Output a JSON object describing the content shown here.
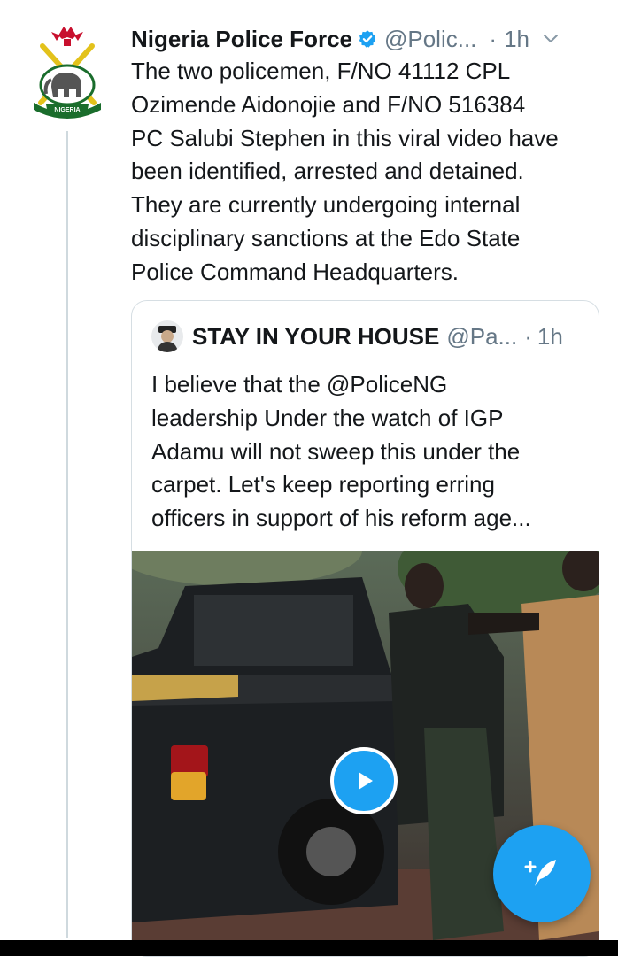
{
  "tweet": {
    "author_name": "Nigeria Police Force",
    "handle": "@Polic...",
    "separator": "·",
    "time": "1h",
    "avatar_label": "NIGERIA",
    "text_lines": [
      "The two policemen, F/NO 41112 CPL",
      "Ozimende Aidonojie and F/NO 516384",
      "PC Salubi Stephen in this viral video have",
      "been identified, arrested and detained.",
      "They are currently undergoing internal",
      "disciplinary sanctions at the Edo State",
      "Police Command Headquarters."
    ]
  },
  "quoted_tweet": {
    "author_name": "STAY IN YOUR HOUSE",
    "handle": "@Pa...",
    "separator": "·",
    "time": "1h",
    "text_lines": [
      "I believe that the @PoliceNG",
      "leadership  Under the watch of IGP",
      "Adamu will not sweep this under the",
      "carpet. Let's keep reporting erring",
      "officers in support of his reform age..."
    ],
    "media": {
      "type": "video",
      "play_icon": "play-icon"
    }
  },
  "icons": {
    "verified": "verified-badge-icon",
    "caret": "chevron-down-icon",
    "compose": "compose-tweet-icon"
  },
  "colors": {
    "accent": "#1da1f2",
    "text": "#14171a",
    "secondary": "#657786",
    "border": "#d6dee3"
  }
}
